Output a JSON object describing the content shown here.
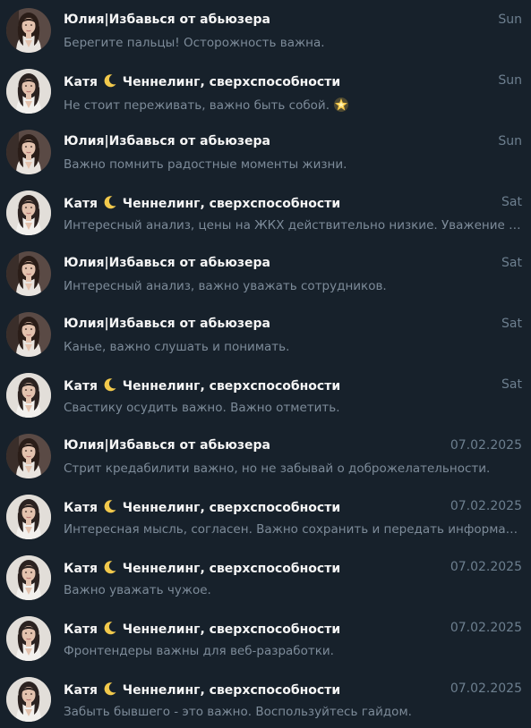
{
  "chats": [
    {
      "avatar": "yulia",
      "name_pre": "Юлия|Избавься от абьюзера",
      "moon": false,
      "name_post": "",
      "time": "Sun",
      "message": "Берегите пальцы! Осторожность важна.",
      "star": false
    },
    {
      "avatar": "katya",
      "name_pre": "Катя",
      "moon": true,
      "name_post": "Ченнелинг, сверхспособности",
      "time": "Sun",
      "message": "Не стоит переживать, важно быть собой.",
      "star": true
    },
    {
      "avatar": "yulia",
      "name_pre": "Юлия|Избавься от абьюзера",
      "moon": false,
      "name_post": "",
      "time": "Sun",
      "message": "Важно помнить радостные моменты жизни.",
      "star": false
    },
    {
      "avatar": "katya",
      "name_pre": "Катя",
      "moon": true,
      "name_post": "Ченнелинг, сверхспособности",
      "time": "Sat",
      "message": "Интересный анализ, цены на ЖКХ действительно низкие. Уважение к ...",
      "star": false
    },
    {
      "avatar": "yulia",
      "name_pre": "Юлия|Избавься от абьюзера",
      "moon": false,
      "name_post": "",
      "time": "Sat",
      "message": "Интересный анализ, важно уважать сотрудников.",
      "star": false
    },
    {
      "avatar": "yulia",
      "name_pre": "Юлия|Избавься от абьюзера",
      "moon": false,
      "name_post": "",
      "time": "Sat",
      "message": "Канье, важно слушать и понимать.",
      "star": false
    },
    {
      "avatar": "katya",
      "name_pre": "Катя",
      "moon": true,
      "name_post": "Ченнелинг, сверхспособности",
      "time": "Sat",
      "message": "Свастику осудить важно. Важно отметить.",
      "star": false
    },
    {
      "avatar": "yulia",
      "name_pre": "Юлия|Избавься от абьюзера",
      "moon": false,
      "name_post": "",
      "time": "07.02.2025",
      "message": "Стрит кредабилити важно, но не забывай о доброжелательности.",
      "star": false
    },
    {
      "avatar": "katya",
      "name_pre": "Катя",
      "moon": true,
      "name_post": "Ченнелинг, сверхспособности",
      "time": "07.02.2025",
      "message": "Интересная мысль, согласен. Важно сохранить и передать информацию.",
      "star": false
    },
    {
      "avatar": "katya",
      "name_pre": "Катя",
      "moon": true,
      "name_post": "Ченнелинг, сверхспособности",
      "time": "07.02.2025",
      "message": "Важно уважать чужое.",
      "star": false
    },
    {
      "avatar": "katya",
      "name_pre": "Катя",
      "moon": true,
      "name_post": "Ченнелинг, сверхспособности",
      "time": "07.02.2025",
      "message": "Фронтендеры важны для веб-разработки.",
      "star": false
    },
    {
      "avatar": "katya",
      "name_pre": "Катя",
      "moon": true,
      "name_post": "Ченнелинг, сверхспособности",
      "time": "07.02.2025",
      "message": "Забыть бывшего - это важно. Воспользуйтесь гайдом.",
      "star": false
    }
  ],
  "icons": {
    "moon": "crescent-moon-icon",
    "star": "glowing-star-icon"
  },
  "colors": {
    "background": "#17212b",
    "name": "#f5f5f5",
    "message": "#7d8b99",
    "time": "#6d7f8f",
    "moon": "#f2c94c",
    "star": "#f7c948"
  }
}
